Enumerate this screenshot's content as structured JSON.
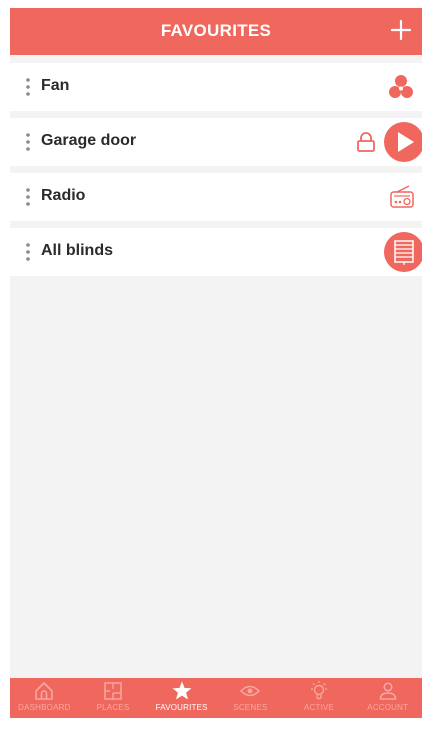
{
  "header": {
    "title": "FAVOURITES",
    "add_icon": "plus-icon"
  },
  "favourites": [
    {
      "label": "Fan",
      "icons": [
        "fan-icon"
      ]
    },
    {
      "label": "Garage door",
      "icons": [
        "lock-icon",
        "play-icon"
      ]
    },
    {
      "label": "Radio",
      "icons": [
        "radio-icon"
      ]
    },
    {
      "label": "All blinds",
      "icons": [
        "blinds-icon"
      ]
    }
  ],
  "tabs": [
    {
      "label": "DASHBOARD",
      "icon": "home-icon",
      "active": false
    },
    {
      "label": "PLACES",
      "icon": "floorplan-icon",
      "active": false
    },
    {
      "label": "FAVOURITES",
      "icon": "star-icon",
      "active": true
    },
    {
      "label": "SCENES",
      "icon": "eye-icon",
      "active": false
    },
    {
      "label": "ACTIVE",
      "icon": "lightbulb-icon",
      "active": false
    },
    {
      "label": "ACCOUNT",
      "icon": "user-icon",
      "active": false
    }
  ],
  "colors": {
    "accent": "#f0675e",
    "background": "#f3f3f3",
    "row": "#ffffff",
    "tab_inactive": "#f7a8a1",
    "tab_active": "#ffffff"
  }
}
